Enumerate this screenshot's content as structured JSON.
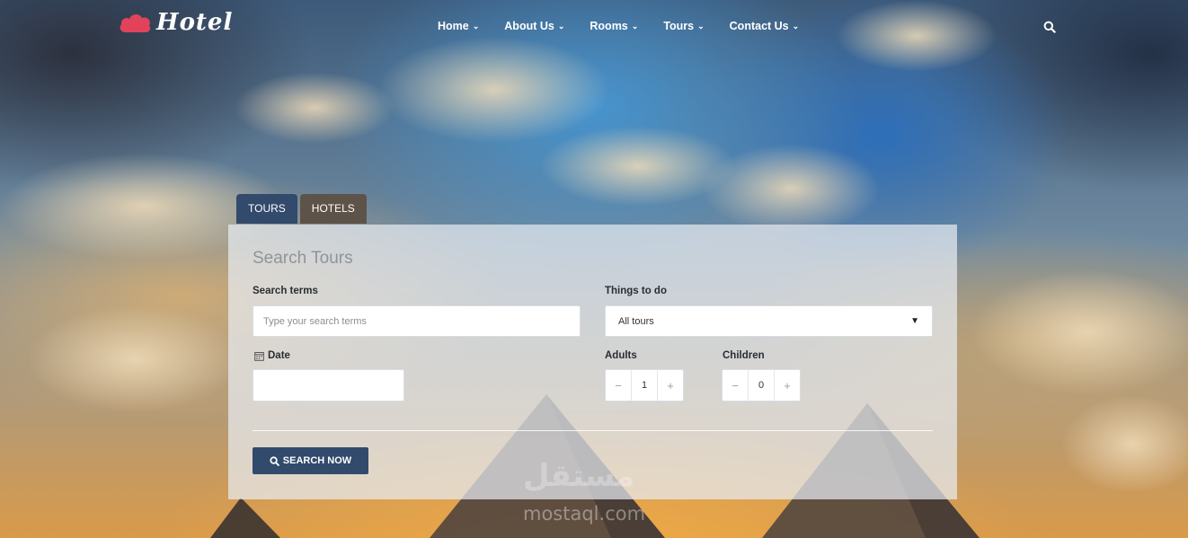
{
  "brand": {
    "name": "Hotel",
    "logo_color": "#e0435a"
  },
  "nav": {
    "items": [
      {
        "label": "Home"
      },
      {
        "label": "About Us"
      },
      {
        "label": "Rooms"
      },
      {
        "label": "Tours"
      },
      {
        "label": "Contact Us"
      }
    ],
    "search_icon": "search-icon"
  },
  "tabs": [
    {
      "label": "TOURS",
      "active": true
    },
    {
      "label": "HOTELS",
      "active": false
    }
  ],
  "search": {
    "title": "Search Tours",
    "terms_label": "Search terms",
    "terms_placeholder": "Type your search terms",
    "things_label": "Things to do",
    "things_value": "All tours",
    "date_label": "Date",
    "date_value": "",
    "adults_label": "Adults",
    "adults_value": "1",
    "children_label": "Children",
    "children_value": "0",
    "button_label": "SEARCH NOW"
  },
  "watermark": {
    "arabic": "مستقل",
    "site": "mostaql.com"
  },
  "colors": {
    "accent": "#324a6b",
    "tab_inactive": "#5e5348"
  }
}
